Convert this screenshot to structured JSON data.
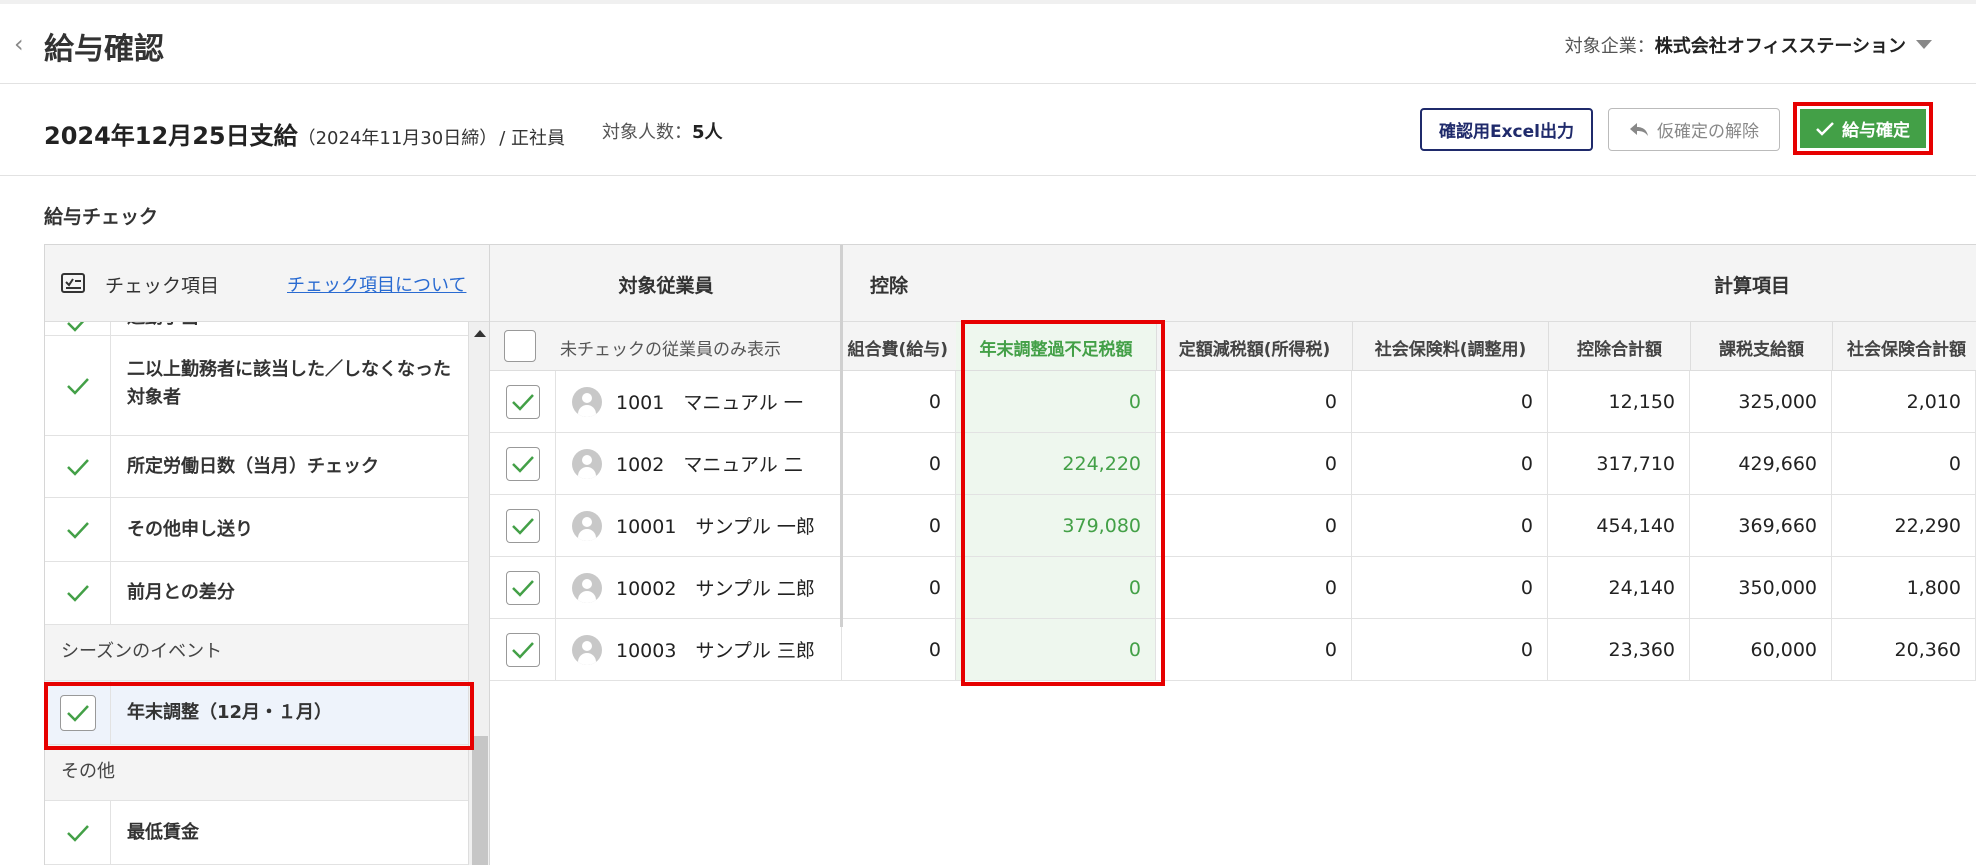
{
  "header": {
    "back_icon": "chevron-left-icon",
    "title": "給与確認",
    "company_label": "対象企業：",
    "company_name": "株式会社オフィスステーション"
  },
  "info": {
    "pay_date": "2024年12月25日支給",
    "closing": "（2024年11月30日締）",
    "employee_type": "/ 正社員",
    "target_label": "対象人数：",
    "target_count": "5人",
    "excel_button": "確認用Excel出力",
    "release_button": "仮確定の解除",
    "confirm_button": "給与確定"
  },
  "section_title": "給与チェック",
  "check_panel": {
    "header_label": "チェック項目",
    "header_link": "チェック項目について",
    "items": [
      {
        "label": "通勤手当"
      },
      {
        "label": "二以上勤務者に該当した／しなくなった対象者"
      },
      {
        "label": "所定労働日数（当月）チェック"
      },
      {
        "label": "その他申し送り"
      },
      {
        "label": "前月との差分"
      }
    ],
    "group_season": "シーズンのイベント",
    "season_item": "年末調整（12月・１月）",
    "group_other": "その他",
    "other_item": "最低賃金"
  },
  "table": {
    "group_employee": "対象従業員",
    "group_deduction": "控除",
    "group_calc": "計算項目",
    "filter_label": "未チェックの従業員のみ表示",
    "columns": [
      "組合費(給与)",
      "年末調整過不足税額",
      "定額減税額(所得税)",
      "社会保険料(調整用)",
      "控除合計額",
      "課税支給額",
      "社会保険合計額"
    ],
    "rows": [
      {
        "employee": "1001　マニュアル 一",
        "union": "0",
        "yearend": "0",
        "taxcut": "0",
        "social_adj": "0",
        "deduction_total": "12,150",
        "taxable": "325,000",
        "social_total": "2,010"
      },
      {
        "employee": "1002　マニュアル 二",
        "union": "0",
        "yearend": "224,220",
        "taxcut": "0",
        "social_adj": "0",
        "deduction_total": "317,710",
        "taxable": "429,660",
        "social_total": "0"
      },
      {
        "employee": "10001　サンプル 一郎",
        "union": "0",
        "yearend": "379,080",
        "taxcut": "0",
        "social_adj": "0",
        "deduction_total": "454,140",
        "taxable": "369,660",
        "social_total": "22,290"
      },
      {
        "employee": "10002　サンプル 二郎",
        "union": "0",
        "yearend": "0",
        "taxcut": "0",
        "social_adj": "0",
        "deduction_total": "24,140",
        "taxable": "350,000",
        "social_total": "1,800"
      },
      {
        "employee": "10003　サンプル 三郎",
        "union": "0",
        "yearend": "0",
        "taxcut": "0",
        "social_adj": "0",
        "deduction_total": "23,360",
        "taxable": "60,000",
        "social_total": "20,360"
      }
    ]
  },
  "colors": {
    "accent_green": "#43a047",
    "highlight_red": "#e60000",
    "link_blue": "#2a6bd1",
    "navy": "#1f2a6b"
  }
}
